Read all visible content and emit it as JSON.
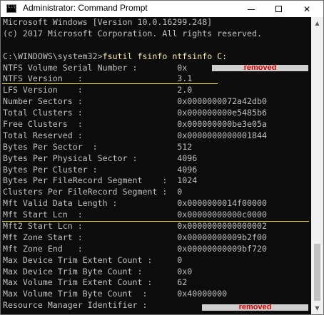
{
  "window": {
    "title": "Administrator: Command Prompt",
    "icon_label": "C:\\",
    "buttons": {
      "minimize": "minimize-icon",
      "maximize": "maximize-icon",
      "close": "✕"
    }
  },
  "console": {
    "lines": [
      "Microsoft Windows [Version 10.0.16299.248]",
      "(c) 2017 Microsoft Corporation. All rights reserved.",
      "",
      {
        "prompt": "C:\\WINDOWS\\system32>",
        "command": "fsutil fsinfo ntfsinfo C:"
      },
      "NTFS Volume Serial Number :        0x",
      "NTFS Version   :                   3.1",
      "LFS Version    :                   2.0",
      "Number Sectors :                   0x0000000072a42db0",
      "Total Clusters :                   0x000000000e5485b6",
      "Free Clusters  :                   0x000000000be3e05a",
      "Total Reserved :                   0x0000000000001844",
      "Bytes Per Sector  :                512",
      "Bytes Per Physical Sector :        4096",
      "Bytes Per Cluster :                4096",
      "Bytes Per FileRecord Segment    :  1024",
      "Clusters Per FileRecord Segment :  0",
      "Mft Valid Data Length :            0x0000000014f00000",
      "Mft Start Lcn  :                   0x00000000000c0000",
      "Mft2 Start Lcn :                   0x0000000000000002",
      "Mft Zone Start :                   0x00000000009b2f00",
      "Mft Zone End   :                   0x00000000009bf720",
      "Max Device Trim Extent Count :     0",
      "Max Device Trim Byte Count :       0x0",
      "Max Volume Trim Extent Count :     62",
      "Max Volume Trim Byte Count  :      0x40000000",
      "Resource Manager Identifier :      "
    ],
    "redaction_label": "removed"
  },
  "colors": {
    "background": "#0c0c0c",
    "text": "#c0c0c0",
    "command": "#f9f1a5",
    "highlight_line": "#f5e642",
    "redaction_text": "#d40000"
  }
}
